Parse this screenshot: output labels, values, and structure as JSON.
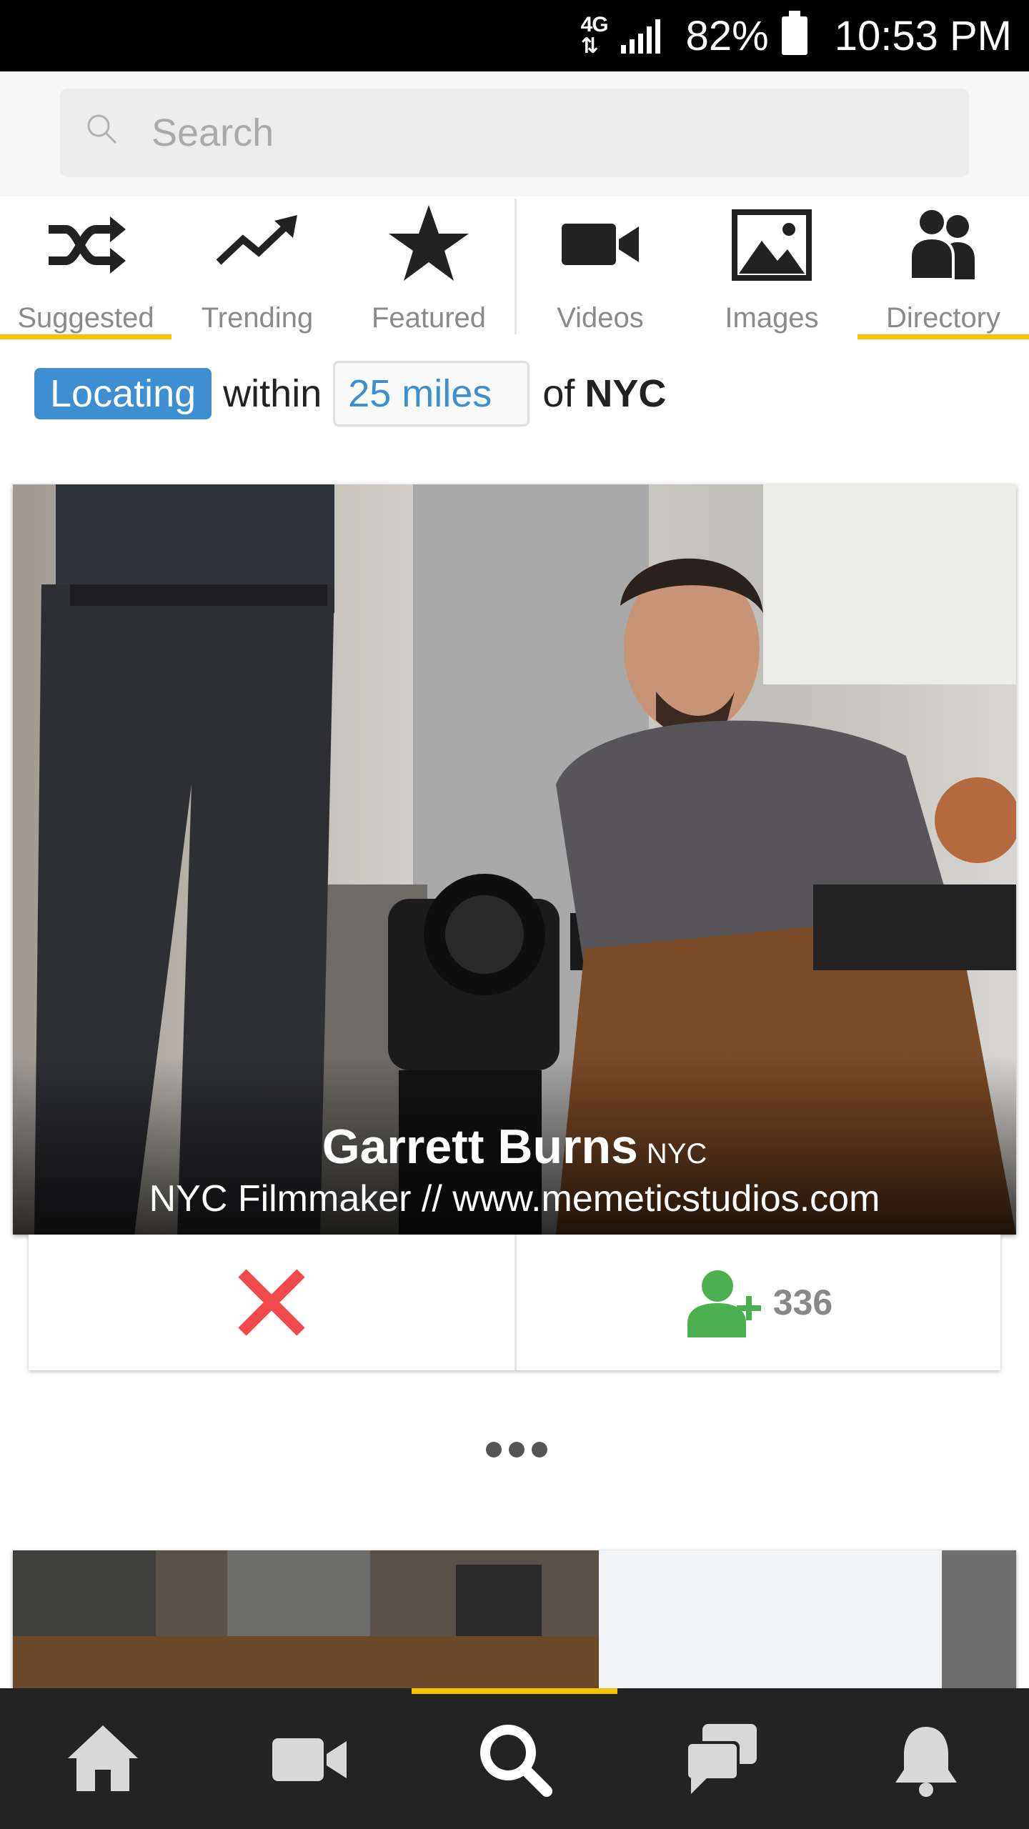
{
  "status_bar": {
    "network": "4G LTE",
    "battery": "82%",
    "time": "10:53 PM"
  },
  "search": {
    "placeholder": "Search"
  },
  "tabs": [
    {
      "label": "Suggested",
      "icon": "shuffle-icon",
      "active": true
    },
    {
      "label": "Trending",
      "icon": "trending-icon",
      "active": false
    },
    {
      "label": "Featured",
      "icon": "star-icon",
      "active": false
    },
    {
      "label": "Videos",
      "icon": "video-camera-icon",
      "active": false
    },
    {
      "label": "Images",
      "icon": "image-icon",
      "active": false
    },
    {
      "label": "Directory",
      "icon": "people-icon",
      "active": true
    }
  ],
  "location_filter": {
    "status": "Locating",
    "within": "within",
    "radius": "25 miles",
    "of": "of",
    "city": "NYC"
  },
  "profile_card": {
    "name": "Garrett Burns",
    "location": "NYC",
    "bio": "NYC Filmmaker // www.memeticstudios.com",
    "follow_count": "336"
  },
  "bottom_nav": [
    {
      "icon": "home-icon",
      "active": false
    },
    {
      "icon": "video-camera-icon",
      "active": false
    },
    {
      "icon": "search-icon",
      "active": true
    },
    {
      "icon": "chat-icon",
      "active": false
    },
    {
      "icon": "bell-icon",
      "active": false
    }
  ],
  "colors": {
    "accent": "#f5c400",
    "locating_badge": "#3d8fd1",
    "dismiss": "#f04a4a",
    "follow": "#4caf50",
    "nav_bg": "#232323"
  }
}
